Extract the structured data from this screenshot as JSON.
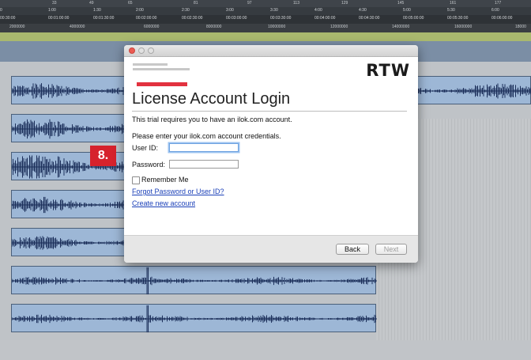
{
  "ruler": {
    "bars": [
      "33",
      "49",
      "65",
      "81",
      "97",
      "113",
      "129",
      "145",
      "161",
      "177"
    ],
    "time": [
      "0",
      "1:00",
      "1:30",
      "2:00",
      "2:30",
      "3:00",
      "3:30",
      "4:00",
      "4:30",
      "5:00",
      "5:30",
      "6:00"
    ],
    "timecode": [
      "00:30:00",
      "00:01:00:00",
      "00:01:30:00",
      "00:02:00:00",
      "00:02:30:00",
      "00:03:00:00",
      "00:03:30:00",
      "00:04:00:00",
      "00:04:30:00",
      "00:05:00:00",
      "00:05:30:00",
      "00:06:00:00"
    ],
    "samples": [
      "2000000",
      "4000000",
      "6000000",
      "8000000",
      "10000000",
      "12000000",
      "14000000",
      "16000000",
      "18000"
    ]
  },
  "step_badge": "8.",
  "dialog": {
    "logo": "RTW",
    "title": "License Account Login",
    "intro": "This trial requires you to have an ilok.com account.",
    "instruction": "Please enter your ilok.com account credentials.",
    "user_id_label": "User ID:",
    "user_id_value": "",
    "password_label": "Password:",
    "password_value": "",
    "remember_label": "Remember Me",
    "remember_checked": false,
    "forgot_link": "Forgot Password or User ID?",
    "create_link": "Create new account",
    "back_button": "Back",
    "next_button": "Next"
  },
  "colors": {
    "accent_red": "#e2323f",
    "badge_red": "#d6222c",
    "waveform": "#1c2f5a",
    "region_blue": "#9db7d6",
    "link": "#1a3fb8"
  }
}
